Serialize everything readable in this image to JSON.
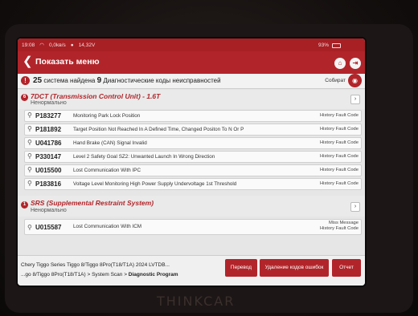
{
  "statusbar": {
    "time": "19:08",
    "speed": "0,0kв/s",
    "voltage": "14,32V",
    "battery": "93%"
  },
  "header": {
    "back_icon": "chevron-left-icon",
    "title": "Показать меню"
  },
  "summary": {
    "systems_count": "25",
    "systems_text": "система найдена",
    "codes_count": "9",
    "codes_text": "Диагностические коды неисправностей",
    "collect_label": "Собират"
  },
  "systems": [
    {
      "index": "6",
      "name": "7DCT (Transmission Control Unit) - 1.6T",
      "state": "Ненормально",
      "faults": [
        {
          "code": "P183277",
          "desc": "Monitoring Park Lock Position",
          "status": "History Fault Code"
        },
        {
          "code": "P181892",
          "desc": "Target Position Not Reached In A Defined Time, Changed Positon To N Or P",
          "status": "History Fault Code"
        },
        {
          "code": "U041786",
          "desc": "Hand Brake (CAN) Signal Invalid",
          "status": "History Fault Code"
        },
        {
          "code": "P330147",
          "desc": "Level 2 Safety Goal SZ2: Unwanted Launch In Wrong Direction",
          "status": "History Fault Code"
        },
        {
          "code": "U015500",
          "desc": "Lost Communication With IPC",
          "status": "History Fault Code"
        },
        {
          "code": "P183816",
          "desc": "Voltage Level Monitoring High Power Supply Undervoltage 1st Threshold",
          "status": "History Fault Code"
        }
      ]
    },
    {
      "index": "1",
      "name": "SRS (Supplemental Restraint System)",
      "state": "Ненормально",
      "faults": [
        {
          "code": "U015587",
          "desc": "Lost Communication With ICM",
          "status": "Miss Message",
          "status2": "History Fault Code"
        }
      ]
    }
  ],
  "footer": {
    "vehicle_line": "Chery  Tiggo Series Tiggo 8/Tiggo 8Pro(T18/T1A)  2024  LVTDB...",
    "path_prefix": "...go 8/Tiggo 8Pro(T18/T1A) > System Scan > ",
    "path_current": "Diagnostic Program",
    "buttons": {
      "translate": "Перевод",
      "clear": "Удаление кодов ошибок",
      "report": "Отчет"
    }
  },
  "brand_text": "THINKCAR",
  "colors": {
    "accent": "#b1252a",
    "background": "#e6e6e6"
  }
}
